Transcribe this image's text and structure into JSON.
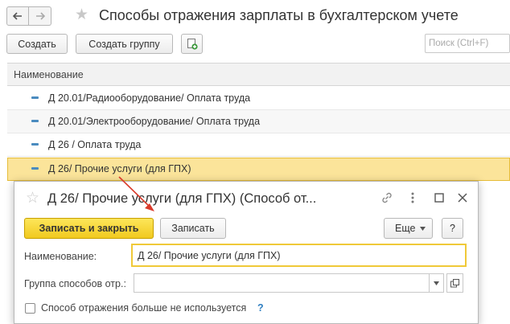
{
  "header": {
    "back_icon": "arrow-left-icon",
    "forward_icon": "arrow-right-icon",
    "star_icon": "star-icon",
    "title": "Способы отражения зарплаты в бухгалтерском учете"
  },
  "toolbar": {
    "create_label": "Создать",
    "create_group_label": "Создать группу",
    "copy_icon": "copy-add-icon",
    "search_placeholder": "Поиск (Ctrl+F)"
  },
  "list": {
    "column_header": "Наименование",
    "rows": [
      {
        "label": "Д 20.01/Радиооборудование/ Оплата труда"
      },
      {
        "label": "Д 20.01/Электрооборудование/ Оплата труда"
      },
      {
        "label": "Д 26 / Оплата труда"
      },
      {
        "label": "Д 26/ Прочие услуги (для ГПХ)"
      }
    ],
    "selected_index": 3
  },
  "dialog": {
    "title": "Д 26/ Прочие услуги (для ГПХ) (Способ от...",
    "buttons": {
      "save_close": "Записать и закрыть",
      "save": "Записать",
      "more": "Еще",
      "help": "?"
    },
    "fields": {
      "name_label": "Наименование:",
      "name_value": "Д 26/ Прочие услуги (для ГПХ)",
      "group_label": "Группа способов отр.:",
      "group_value": "",
      "checkbox_label": "Способ отражения больше не используется",
      "checkbox_checked": false,
      "help_mark": "?"
    }
  },
  "colors": {
    "accent_yellow": "#f1c91f",
    "selection": "#fbe49a",
    "arrow": "#d93a2b",
    "link_blue": "#2f7fc1"
  }
}
